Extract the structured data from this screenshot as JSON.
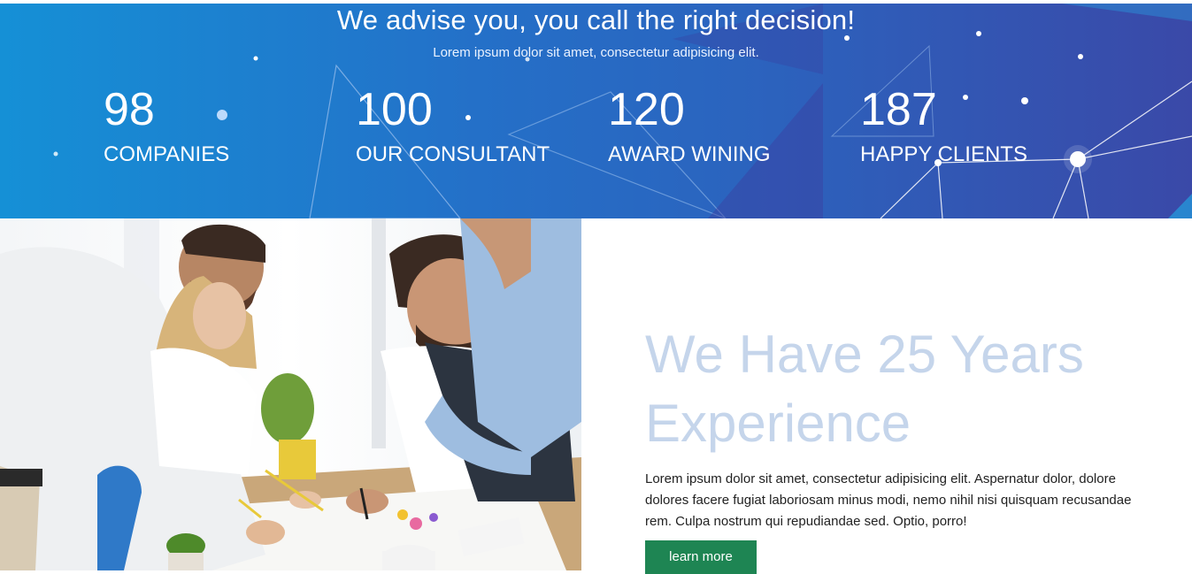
{
  "stats_section": {
    "headline": "We advise you, you call the right decision!",
    "subline": "Lorem ipsum dolor sit amet, consectetur adipisicing elit.",
    "stats": [
      {
        "number": "98",
        "label": "COMPANIES"
      },
      {
        "number": "100",
        "label": "OUR CONSULTANT"
      },
      {
        "number": "120",
        "label": "AWARD WINING"
      },
      {
        "number": "187",
        "label": "HAPPY CLIENTS"
      }
    ]
  },
  "about": {
    "title_line1": "We Have 25 Years",
    "title_line2": "Experience",
    "body": "Lorem ipsum dolor sit amet, consectetur adipisicing elit. Aspernatur dolor, dolore dolores facere fugiat laboriosam minus modi, nemo nihil nisi quisquam recusandae rem. Culpa nostrum qui repudiandae sed. Optio, porro!",
    "button_label": "learn more"
  },
  "colors": {
    "band_start": "#1590d6",
    "band_end": "#3a49a8",
    "title_color": "#c5d5eb",
    "button": "#1e8553"
  }
}
